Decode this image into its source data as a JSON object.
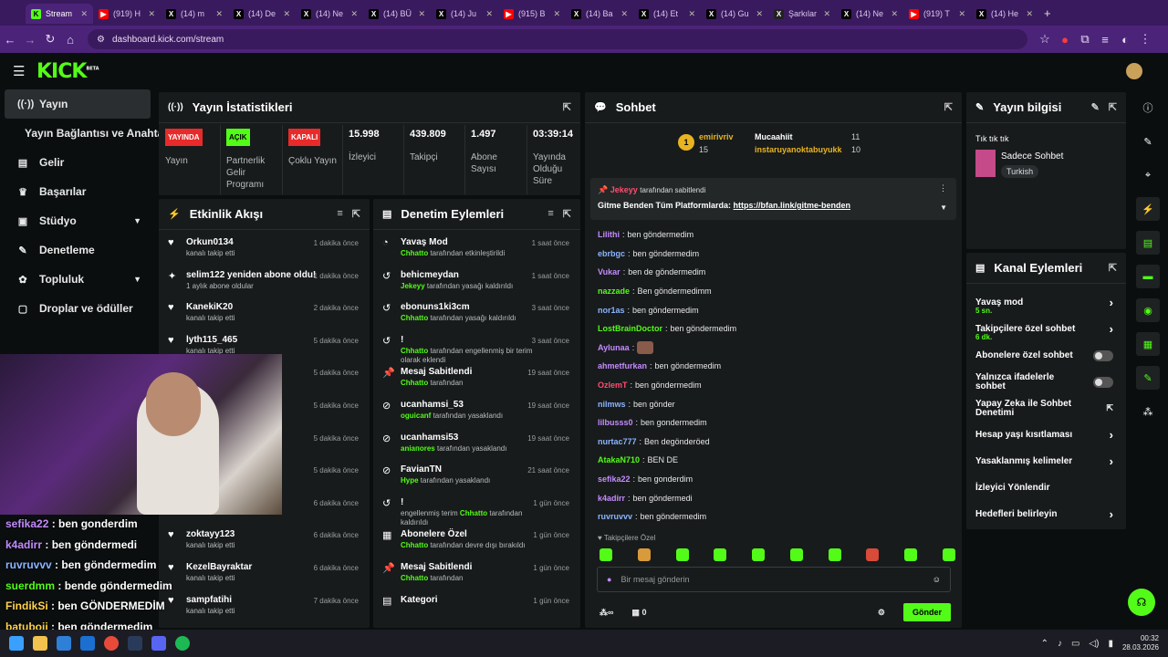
{
  "browser": {
    "tabs": [
      "Stream",
      "(919) H",
      "(14) m",
      "(14) De",
      "(14) Ne",
      "(14) BÜ",
      "(14) Ju",
      "(915) B",
      "(14) Ba",
      "(14) Et",
      "(14) Gu",
      "Şarkılar",
      "(14) Ne",
      "(919) T",
      "(14) He"
    ],
    "url": "dashboard.kick.com/stream"
  },
  "sidebar": {
    "items": [
      "Yayın",
      "Yayın Bağlantısı ve Anahtarı",
      "Gelir",
      "Başarılar",
      "Stüdyo",
      "Denetleme",
      "Topluluk",
      "Droplar ve ödüller"
    ]
  },
  "stats": {
    "title": "Yayın İstatistikleri",
    "cells": [
      {
        "badge": "YAYINDA",
        "label": "Yayın"
      },
      {
        "badge": "AÇIK",
        "label": "Partnerlik Gelir Programı"
      },
      {
        "badge": "KAPALI",
        "label": "Çoklu Yayın"
      },
      {
        "value": "15.998",
        "label": "İzleyici"
      },
      {
        "value": "439.809",
        "label": "Takipçi"
      },
      {
        "value": "1.497",
        "label": "Abone Sayısı"
      },
      {
        "value": "03:39:14",
        "label": "Yayında Olduğu Süre"
      }
    ]
  },
  "activity": {
    "title": "Etkinlik Akışı",
    "rows": [
      {
        "icon": "heart",
        "name": "Orkun0134",
        "sub": "kanalı takip etti",
        "time": "1 dakika önce"
      },
      {
        "icon": "sparkle",
        "name": "selim122 yeniden abone oldu!",
        "sub": "1 aylık abone oldular",
        "time": "1 dakika önce"
      },
      {
        "icon": "heart",
        "name": "KanekiK20",
        "sub": "kanalı takip etti",
        "time": "2 dakika önce"
      },
      {
        "icon": "heart",
        "name": "lyth115_465",
        "sub": "kanalı takip etti",
        "time": "5 dakika önce"
      },
      {
        "icon": "heart",
        "name": "",
        "sub": "",
        "time": "5 dakika önce"
      },
      {
        "icon": "heart",
        "name": "",
        "sub": "",
        "time": "5 dakika önce"
      },
      {
        "icon": "heart",
        "name": "",
        "sub": "",
        "time": "5 dakika önce"
      },
      {
        "icon": "heart",
        "name": "",
        "sub": "",
        "time": "5 dakika önce"
      },
      {
        "icon": "heart",
        "name": "",
        "sub": "kanalı takip etti",
        "time": "6 dakika önce"
      },
      {
        "icon": "heart",
        "name": "zoktayy123",
        "sub": "kanalı takip etti",
        "time": "6 dakika önce"
      },
      {
        "icon": "heart",
        "name": "KezelBayraktar",
        "sub": "kanalı takip etti",
        "time": "6 dakika önce"
      },
      {
        "icon": "heart",
        "name": "sampfatihi",
        "sub": "kanalı takip etti",
        "time": "7 dakika önce"
      }
    ]
  },
  "moderation": {
    "title": "Denetim Eylemleri",
    "rows": [
      {
        "icon": "slow",
        "name": "Yavaş Mod",
        "g": "Chhatto",
        "sub": " tarafından etkinleştirildi",
        "time": "1 saat önce"
      },
      {
        "icon": "undo",
        "name": "behicmeydan",
        "g": "Jekeyy",
        "sub": " tarafından yasağı kaldırıldı",
        "time": "1 saat önce"
      },
      {
        "icon": "undo",
        "name": "ebonuns1ki3cm",
        "g": "Chhatto",
        "sub": " tarafından yasağı kaldırıldı",
        "time": "3 saat önce"
      },
      {
        "icon": "undo",
        "name": "!",
        "g": "Chhatto",
        "sub": " tarafından engellenmiş bir terim olarak eklendi",
        "time": "3 saat önce"
      },
      {
        "icon": "pin",
        "name": "Mesaj Sabitlendi",
        "g": "Chhatto",
        "sub": " tarafından",
        "time": "19 saat önce"
      },
      {
        "icon": "ban",
        "name": "ucanhamsi_53",
        "g": "oguicanf",
        "sub": " tarafından yasaklandı",
        "time": "19 saat önce"
      },
      {
        "icon": "ban",
        "name": "ucanhamsi53",
        "g": "aniaпores",
        "sub": " tarafından yasaklandı",
        "time": "19 saat önce"
      },
      {
        "icon": "ban",
        "name": "FavianTN",
        "g": "Hype",
        "sub": " tarafından yasaklandı",
        "time": "21 saat önce"
      },
      {
        "icon": "undo",
        "name": "!",
        "g": "Chhatto",
        "sub": " tarafından kaldırıldı",
        "pre": "engellenmiş terim ",
        "time": "1 gün önce"
      },
      {
        "icon": "gift",
        "name": "Abonelere Özel",
        "g": "Chhatto",
        "sub": " tarafından devre dışı bırakıldı",
        "time": "1 gün önce"
      },
      {
        "icon": "pin",
        "name": "Mesaj Sabitlendi",
        "g": "Chhatto",
        "sub": " tarafından",
        "time": "1 gün önce"
      },
      {
        "icon": "cat",
        "name": "Kategori",
        "g": "",
        "sub": "",
        "time": "1 gün önce"
      }
    ]
  },
  "chat": {
    "title": "Sohbet",
    "top": [
      {
        "rank": "1",
        "name": "emirivriv",
        "count": "15"
      },
      {
        "name": "Mucaahiit",
        "count": "11"
      },
      {
        "name": "instaruyanoktabuyukk",
        "count": "10"
      }
    ],
    "pinned": {
      "user": "Jekeyy",
      "by": "tarafından sabitlendi",
      "text": "Gitme Benden Tüm Platformlarda: ",
      "link": "https://bfan.link/gitme-benden"
    },
    "messages": [
      {
        "user": "Lilithi",
        "color": "#c48bff",
        "text": "ben göndermedim"
      },
      {
        "user": "ebrbgc",
        "color": "#8ab4ff",
        "text": "ben göndermedim"
      },
      {
        "user": "Vukar",
        "color": "#c48bff",
        "text": "ben de göndermedim"
      },
      {
        "user": "nazzade",
        "color": "#53fc18",
        "text": "Ben göndermedimm"
      },
      {
        "user": "nor1as",
        "color": "#8ab4ff",
        "text": "ben göndermedim"
      },
      {
        "user": "LostBrainDoctor",
        "color": "#53fc18",
        "text": "ben göndermedim"
      },
      {
        "user": "Aylunaa",
        "color": "#c48bff",
        "text": ""
      },
      {
        "user": "ahmetfurkan",
        "color": "#c48bff",
        "text": "ben göndermedim"
      },
      {
        "user": "OzlemT",
        "color": "#ff4d6d",
        "text": "ben göndermedim"
      },
      {
        "user": "nilmws",
        "color": "#8ab4ff",
        "text": "ben gönder"
      },
      {
        "user": "lilbusss0",
        "color": "#c48bff",
        "text": "ben gondermedim"
      },
      {
        "user": "nurtac777",
        "color": "#8ab4ff",
        "text": "Ben degönderöed"
      },
      {
        "user": "AtakaN710",
        "color": "#53fc18",
        "text": "BEN DE"
      },
      {
        "user": "sefika22",
        "color": "#c48bff",
        "text": "ben gonderdim"
      },
      {
        "user": "k4adirr",
        "color": "#c48bff",
        "text": "ben göndermedi"
      },
      {
        "user": "ruvruvvv",
        "color": "#8ab4ff",
        "text": "ben göndermedim"
      }
    ],
    "followers_label": "Takipçilere Özel",
    "input_placeholder": "Bir mesaj gönderin",
    "count": "0",
    "send": "Gönder"
  },
  "info": {
    "title": "Yayın bilgisi",
    "stream_title": "Tık tık tık",
    "category": "Sadece Sohbet",
    "tag": "Turkish"
  },
  "channel": {
    "title": "Kanal Eylemleri",
    "rows": [
      {
        "label": "Yavaş mod",
        "value": "5 sn.",
        "ctl": "chev"
      },
      {
        "label": "Takipçilere özel sohbet",
        "value": "6 dk.",
        "ctl": "chev"
      },
      {
        "label": "Abonelere özel sohbet",
        "ctl": "toggle"
      },
      {
        "label": "Yalnızca ifadelerle sohbet",
        "ctl": "toggle"
      },
      {
        "label": "Yapay Zeka ile Sohbet Denetimi",
        "ctl": "ext"
      },
      {
        "label": "Hesap yaşı kısıtlaması",
        "ctl": "chev"
      },
      {
        "label": "Yasaklanmış kelimeler",
        "ctl": "chev"
      },
      {
        "label": "İzleyici Yönlendir",
        "ctl": ""
      },
      {
        "label": "Hedefleri belirleyin",
        "ctl": "chev"
      }
    ]
  },
  "overlay_chat": [
    {
      "user": "sefika22",
      "color": "#c48bff",
      "text": " : ben gonderdim"
    },
    {
      "user": "k4adirr",
      "color": "#c48bff",
      "text": " : ben göndermedi"
    },
    {
      "user": "ruvruvvv",
      "color": "#8ab4ff",
      "text": " : ben göndermedim"
    },
    {
      "user": "suerdmm",
      "color": "#53fc18",
      "text": " : bende göndermedim"
    },
    {
      "user": "FindikSi",
      "color": "#ffd34d",
      "text": " : ben GÖNDERMEDİM"
    },
    {
      "user": "batuboii",
      "color": "#ffd34d",
      "text": " : ben göndermedim"
    }
  ],
  "taskbar": {
    "time": "00:32",
    "date": "28.03.2026"
  },
  "colors": {
    "accent": "#53fc18",
    "panel": "#181b1c",
    "bg": "#0b0e0f",
    "browser": "#4b2479"
  }
}
